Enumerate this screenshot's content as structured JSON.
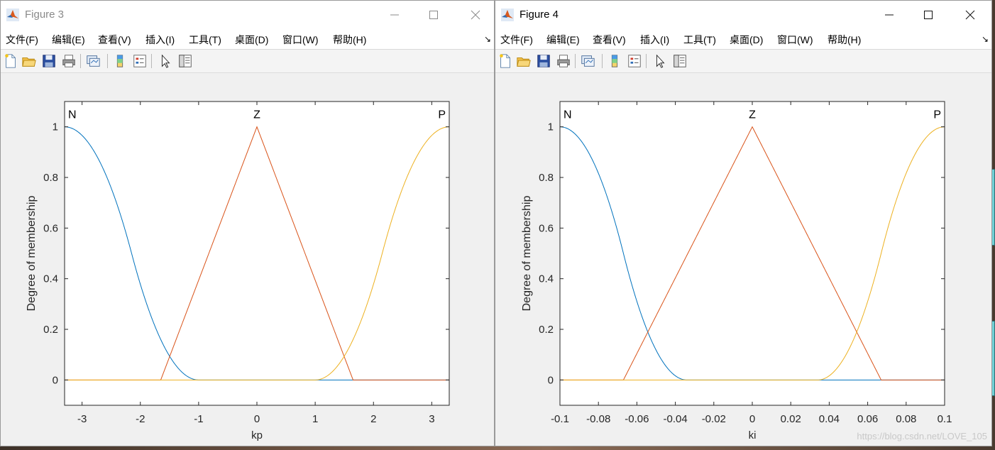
{
  "menu_labels": [
    "文件(F)",
    "编辑(E)",
    "查看(V)",
    "插入(I)",
    "工具(T)",
    "桌面(D)",
    "窗口(W)",
    "帮助(H)"
  ],
  "figure3": {
    "title": "Figure 3",
    "active": false
  },
  "figure4": {
    "title": "Figure 4",
    "active": true
  },
  "watermark": "https://blog.csdn.net/LOVE_105",
  "toolbar_icons": [
    "new-file-icon",
    "open-folder-icon",
    "save-icon",
    "print-icon",
    "link-plot-icon",
    "colorbar-icon",
    "legend-icon",
    "pointer-icon",
    "property-editor-icon"
  ],
  "colors": {
    "blue": "#0072BD",
    "orange": "#D95319",
    "yellow": "#EDB120"
  },
  "chart_data": [
    {
      "type": "line",
      "xlabel": "kp",
      "ylabel": "Degree of membership",
      "xlim": [
        -3.3,
        3.3
      ],
      "ylim": [
        -0.1,
        1.1
      ],
      "xticks": [
        -3,
        -2,
        -1,
        0,
        1,
        2,
        3
      ],
      "xtick_labels": [
        "-3",
        "-2",
        "-1",
        "0",
        "1",
        "2",
        "3"
      ],
      "yticks": [
        0,
        0.2,
        0.4,
        0.6,
        0.8,
        1
      ],
      "ytick_labels": [
        "0",
        "0.2",
        "0.4",
        "0.6",
        "0.8",
        "1"
      ],
      "series": [
        {
          "name": "N",
          "shape": "zmf",
          "params": [
            -3.3,
            -1.0
          ],
          "color": "#0072BD"
        },
        {
          "name": "Z",
          "shape": "trimf",
          "params": [
            -1.65,
            0,
            1.65
          ],
          "color": "#D95319"
        },
        {
          "name": "P",
          "shape": "smf",
          "params": [
            1.0,
            3.3
          ],
          "color": "#EDB120"
        }
      ],
      "mf_labels": [
        {
          "text": "N",
          "x": -3.3
        },
        {
          "text": "Z",
          "x": 0
        },
        {
          "text": "P",
          "x": 3.3
        }
      ]
    },
    {
      "type": "line",
      "xlabel": "ki",
      "ylabel": "Degree of membership",
      "xlim": [
        -0.1,
        0.1
      ],
      "ylim": [
        -0.1,
        1.1
      ],
      "xticks": [
        -0.1,
        -0.08,
        -0.06,
        -0.04,
        -0.02,
        0,
        0.02,
        0.04,
        0.06,
        0.08,
        0.1
      ],
      "xtick_labels": [
        "-0.1",
        "-0.08",
        "-0.06",
        "-0.04",
        "-0.02",
        "0",
        "0.02",
        "0.04",
        "0.06",
        "0.08",
        "0.1"
      ],
      "yticks": [
        0,
        0.2,
        0.4,
        0.6,
        0.8,
        1
      ],
      "ytick_labels": [
        "0",
        "0.2",
        "0.4",
        "0.6",
        "0.8",
        "1"
      ],
      "series": [
        {
          "name": "N",
          "shape": "zmf",
          "params": [
            -0.1,
            -0.034
          ],
          "color": "#0072BD"
        },
        {
          "name": "Z",
          "shape": "trimf",
          "params": [
            -0.067,
            0,
            0.067
          ],
          "color": "#D95319"
        },
        {
          "name": "P",
          "shape": "smf",
          "params": [
            0.034,
            0.1
          ],
          "color": "#EDB120"
        }
      ],
      "mf_labels": [
        {
          "text": "N",
          "x": -0.1
        },
        {
          "text": "Z",
          "x": 0
        },
        {
          "text": "P",
          "x": 0.1
        }
      ]
    }
  ]
}
